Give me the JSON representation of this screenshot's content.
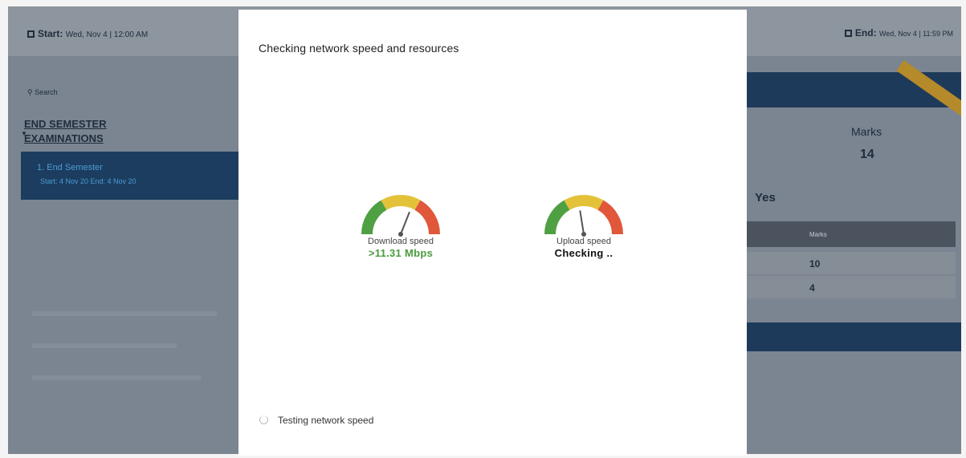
{
  "background": {
    "start_label": "Start:",
    "start_value": "Wed, Nov 4 | 12:00 AM",
    "end_label": "End:",
    "end_value": "Wed, Nov 4 | 11:59 PM",
    "search_placeholder": "Search",
    "section_title_line1": "END SEMESTER",
    "section_title_line2": "EXAMINATIONS",
    "selected_item_title": "1. End Semester",
    "selected_item_dates": "Start: 4 Nov 20   End: 4 Nov 20",
    "marks_label": "Marks",
    "marks_value": "14",
    "yes_label": "Yes",
    "table_header": "Marks",
    "rows": [
      "10",
      "4"
    ]
  },
  "modal": {
    "title": "Checking network speed and resources",
    "download": {
      "label": "Download speed",
      "value": ">11.31 Mbps",
      "needle_fraction": 0.62
    },
    "upload": {
      "label": "Upload speed",
      "value": "Checking ..",
      "needle_fraction": 0.45
    },
    "status_text": "Testing network speed"
  },
  "colors": {
    "gauge_low": "#4fa042",
    "gauge_mid": "#e3c23a",
    "gauge_high": "#e0573a",
    "value_green": "#4c9a3e"
  }
}
